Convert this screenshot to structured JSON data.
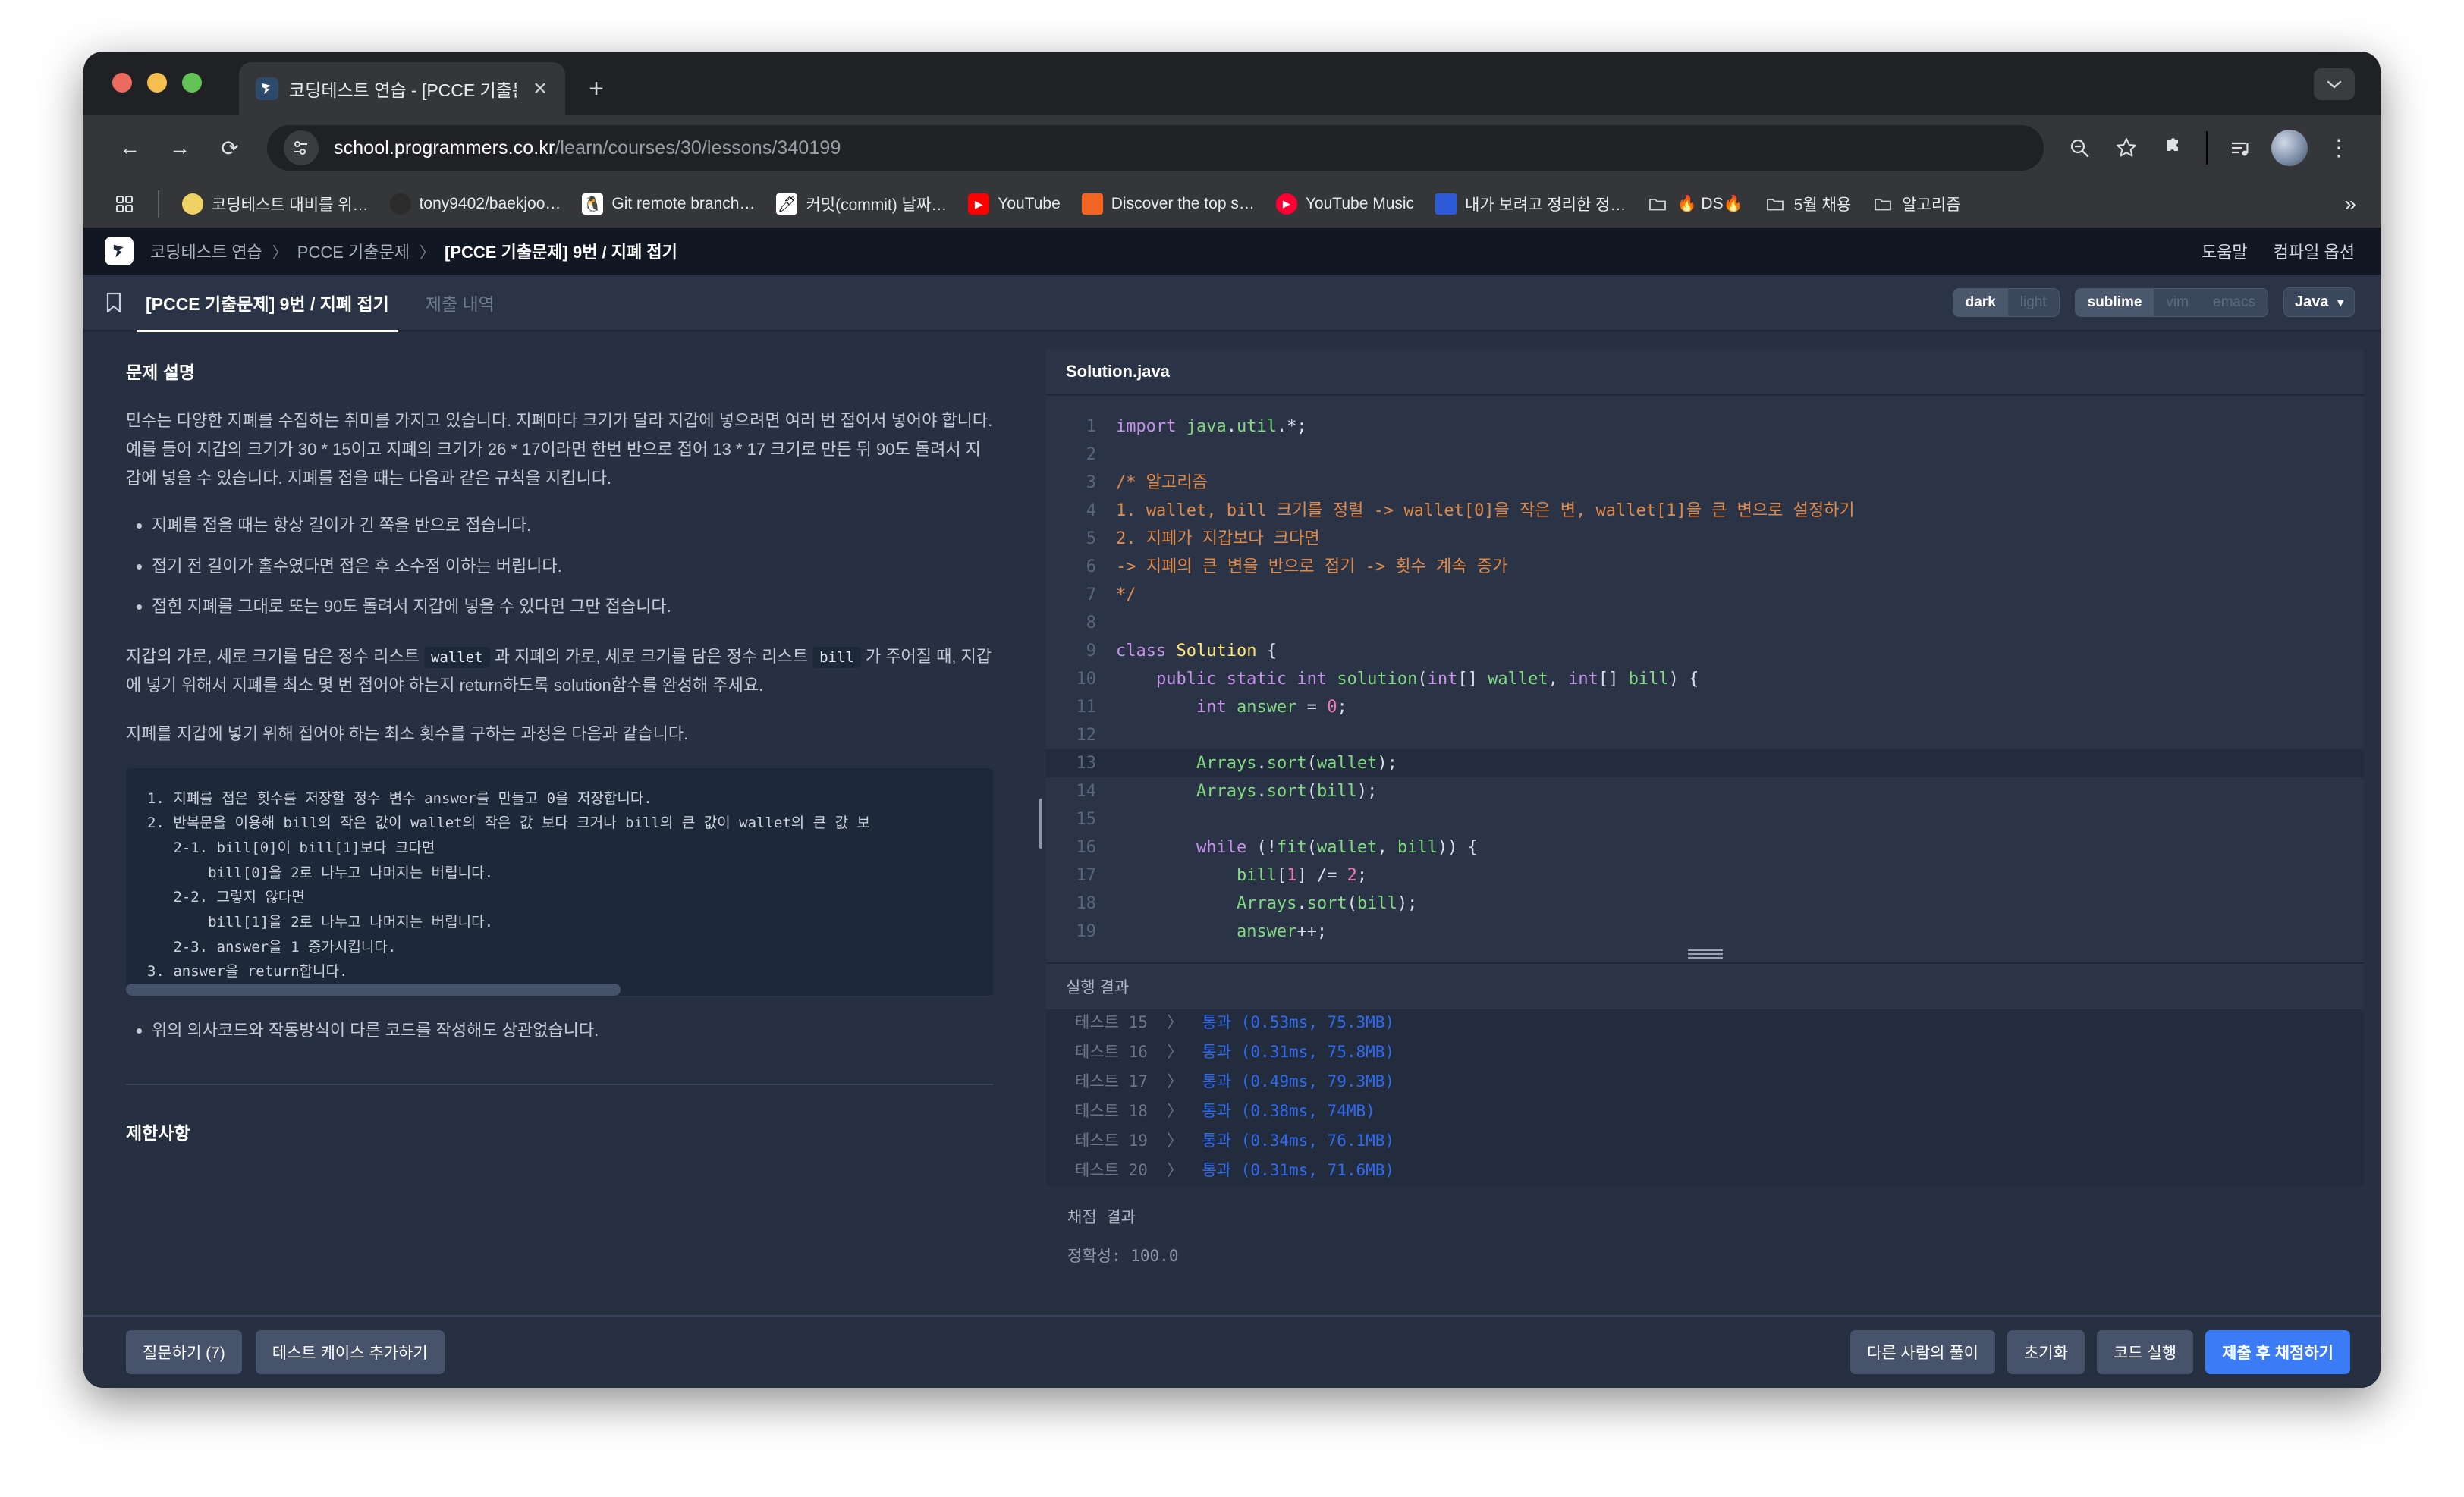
{
  "browser": {
    "tab": {
      "title": "코딩테스트 연습 - [PCCE 기출문",
      "close": "✕"
    },
    "newtab_label": "+",
    "window_controls": {
      "minimize": "",
      "maximize": "",
      "close": ""
    },
    "toolbar": {
      "back": "←",
      "forward": "→",
      "reload": "⟳",
      "url_host": "school.programmers.co.kr",
      "url_path": "/learn/courses/30/lessons/340199",
      "zoom_icon": "zoom-out-icon",
      "bookmark_icon": "star-icon",
      "extensions_icon": "puzzle-icon",
      "media_icon": "media-list-icon",
      "menu_icon": "⋮"
    },
    "bookmarks": [
      {
        "label": "코딩테스트 대비를 위…",
        "icon": "🟡"
      },
      {
        "label": "tony9402/baekjoo…",
        "icon": "⚫"
      },
      {
        "label": "Git remote branch…",
        "icon": "🐧"
      },
      {
        "label": "커밋(commit) 날짜…",
        "icon": "🖊"
      },
      {
        "label": "YouTube",
        "icon": "▶"
      },
      {
        "label": "Discover the top s…",
        "icon": "📊"
      },
      {
        "label": "YouTube Music",
        "icon": "⏵"
      },
      {
        "label": "내가 보려고 정리한 정…",
        "icon": "📘"
      },
      {
        "label": "🔥 DS🔥",
        "icon": "📁"
      },
      {
        "label": "5월 채용",
        "icon": "📁"
      },
      {
        "label": "알고리즘",
        "icon": "📁"
      }
    ],
    "bookmarks_overflow": "»"
  },
  "header": {
    "breadcrumb": [
      {
        "label": "코딩테스트 연습",
        "active": false
      },
      {
        "label": "PCCE 기출문제",
        "active": false
      },
      {
        "label": "[PCCE 기출문제] 9번 / 지폐 접기",
        "active": true
      }
    ],
    "separator": "〉",
    "links": [
      "도움말",
      "컴파일 옵션"
    ]
  },
  "tabs": {
    "items": [
      {
        "label": "[PCCE 기출문제] 9번 / 지폐 접기",
        "active": true
      },
      {
        "label": "제출 내역",
        "active": false
      }
    ],
    "theme_segment": {
      "options": [
        "dark",
        "light"
      ],
      "selected": "dark"
    },
    "keymap_segment": {
      "options": [
        "sublime",
        "vim",
        "emacs"
      ],
      "selected": "sublime"
    },
    "language": {
      "value": "Java",
      "caret": "▾"
    }
  },
  "problem": {
    "section_title": "문제 설명",
    "paragraph1": "민수는 다양한 지폐를 수집하는 취미를 가지고 있습니다. 지폐마다 크기가 달라 지갑에 넣으려면 여러 번 접어서 넣어야 합니다. 예를 들어 지갑의 크기가 30 * 15이고 지폐의 크기가 26 * 17이라면 한번 반으로 접어 13 * 17 크기로 만든 뒤 90도 돌려서 지갑에 넣을 수 있습니다. 지폐를 접을 때는 다음과 같은 규칙을 지킵니다.",
    "rules": [
      "지폐를 접을 때는 항상 길이가 긴 쪽을 반으로 접습니다.",
      "접기 전 길이가 홀수였다면 접은 후 소수점 이하는 버립니다.",
      "접힌 지폐를 그대로 또는 90도 돌려서 지갑에 넣을 수 있다면 그만 접습니다."
    ],
    "paragraph2_pre": "지갑의 가로, 세로 크기를 담은 정수 리스트 ",
    "code_wallet": "wallet",
    "paragraph2_mid": " 과 지폐의 가로, 세로 크기를 담은 정수 리스트 ",
    "code_bill": "bill",
    "paragraph2_post": " 가 주어질 때, 지갑에 넣기 위해서 지폐를 최소 몇 번 접어야 하는지 return하도록 solution함수를 완성해 주세요.",
    "paragraph3": "지폐를 지갑에 넣기 위해 접어야 하는 최소 횟수를 구하는 과정은 다음과 같습니다.",
    "pseudocode": "1. 지폐를 접은 횟수를 저장할 정수 변수 answer를 만들고 0을 저장합니다.\n2. 반복문을 이용해 bill의 작은 값이 wallet의 작은 값 보다 크거나 bill의 큰 값이 wallet의 큰 값 보\n   2-1. bill[0]이 bill[1]보다 크다면\n       bill[0]을 2로 나누고 나머지는 버립니다.\n   2-2. 그렇지 않다면\n       bill[1]을 2로 나누고 나머지는 버립니다.\n   2-3. answer을 1 증가시킵니다.\n3. answer을 return합니다.",
    "note": "위의 의사코드와 작동방식이 다른 코드를 작성해도 상관없습니다.",
    "constraints_title": "제한사항"
  },
  "editor": {
    "filename": "Solution.java",
    "lines": [
      {
        "n": 1,
        "tokens": [
          {
            "t": "import ",
            "c": "k"
          },
          {
            "t": "java",
            "c": "fn"
          },
          {
            "t": ".",
            "c": "ct"
          },
          {
            "t": "util",
            "c": "fn"
          },
          {
            "t": ".*;",
            "c": "ct"
          }
        ]
      },
      {
        "n": 2,
        "tokens": []
      },
      {
        "n": 3,
        "tokens": [
          {
            "t": "/* 알고리즘",
            "c": "cm"
          }
        ]
      },
      {
        "n": 4,
        "tokens": [
          {
            "t": "1. wallet, bill 크기를 정렬 -> wallet[0]을 작은 변, wallet[1]을 큰 변으로 설정하기",
            "c": "cm"
          }
        ]
      },
      {
        "n": 5,
        "tokens": [
          {
            "t": "2. 지폐가 지갑보다 크다면",
            "c": "cm"
          }
        ]
      },
      {
        "n": 6,
        "tokens": [
          {
            "t": "-> 지폐의 큰 변을 반으로 접기 -> 횟수 계속 증가",
            "c": "cm"
          }
        ]
      },
      {
        "n": 7,
        "tokens": [
          {
            "t": "*/",
            "c": "cm"
          }
        ]
      },
      {
        "n": 8,
        "tokens": []
      },
      {
        "n": 9,
        "tokens": [
          {
            "t": "class ",
            "c": "k"
          },
          {
            "t": "Solution",
            "c": "cls"
          },
          {
            "t": " {",
            "c": "ct"
          }
        ]
      },
      {
        "n": 10,
        "tokens": [
          {
            "t": "    public static ",
            "c": "k"
          },
          {
            "t": "int ",
            "c": "k"
          },
          {
            "t": "solution",
            "c": "fn"
          },
          {
            "t": "(",
            "c": "ct"
          },
          {
            "t": "int",
            "c": "k"
          },
          {
            "t": "[] ",
            "c": "ct"
          },
          {
            "t": "wallet",
            "c": "fn"
          },
          {
            "t": ", ",
            "c": "ct"
          },
          {
            "t": "int",
            "c": "k"
          },
          {
            "t": "[] ",
            "c": "ct"
          },
          {
            "t": "bill",
            "c": "fn"
          },
          {
            "t": ") {",
            "c": "ct"
          }
        ]
      },
      {
        "n": 11,
        "tokens": [
          {
            "t": "        int ",
            "c": "k"
          },
          {
            "t": "answer",
            "c": "fn"
          },
          {
            "t": " = ",
            "c": "ct"
          },
          {
            "t": "0",
            "c": "num"
          },
          {
            "t": ";",
            "c": "ct"
          }
        ]
      },
      {
        "n": 12,
        "tokens": []
      },
      {
        "n": 13,
        "tokens": [
          {
            "t": "        ",
            "c": "ct"
          },
          {
            "t": "Arrays",
            "c": "fn"
          },
          {
            "t": ".",
            "c": "ct"
          },
          {
            "t": "sort",
            "c": "fn"
          },
          {
            "t": "(",
            "c": "ct"
          },
          {
            "t": "wallet",
            "c": "fn"
          },
          {
            "t": ");",
            "c": "ct"
          }
        ],
        "highlight": true
      },
      {
        "n": 14,
        "tokens": [
          {
            "t": "        ",
            "c": "ct"
          },
          {
            "t": "Arrays",
            "c": "fn"
          },
          {
            "t": ".",
            "c": "ct"
          },
          {
            "t": "sort",
            "c": "fn"
          },
          {
            "t": "(",
            "c": "ct"
          },
          {
            "t": "bill",
            "c": "fn"
          },
          {
            "t": ");",
            "c": "ct"
          }
        ]
      },
      {
        "n": 15,
        "tokens": []
      },
      {
        "n": 16,
        "tokens": [
          {
            "t": "        ",
            "c": "ct"
          },
          {
            "t": "while",
            "c": "k"
          },
          {
            "t": " (!",
            "c": "ct"
          },
          {
            "t": "fit",
            "c": "fn"
          },
          {
            "t": "(",
            "c": "ct"
          },
          {
            "t": "wallet",
            "c": "fn"
          },
          {
            "t": ", ",
            "c": "ct"
          },
          {
            "t": "bill",
            "c": "fn"
          },
          {
            "t": ")) {",
            "c": "ct"
          }
        ]
      },
      {
        "n": 17,
        "tokens": [
          {
            "t": "            ",
            "c": "ct"
          },
          {
            "t": "bill",
            "c": "fn"
          },
          {
            "t": "[",
            "c": "ct"
          },
          {
            "t": "1",
            "c": "num"
          },
          {
            "t": "] /= ",
            "c": "ct"
          },
          {
            "t": "2",
            "c": "num"
          },
          {
            "t": ";",
            "c": "ct"
          }
        ]
      },
      {
        "n": 18,
        "tokens": [
          {
            "t": "            ",
            "c": "ct"
          },
          {
            "t": "Arrays",
            "c": "fn"
          },
          {
            "t": ".",
            "c": "ct"
          },
          {
            "t": "sort",
            "c": "fn"
          },
          {
            "t": "(",
            "c": "ct"
          },
          {
            "t": "bill",
            "c": "fn"
          },
          {
            "t": ");",
            "c": "ct"
          }
        ]
      },
      {
        "n": 19,
        "tokens": [
          {
            "t": "            ",
            "c": "ct"
          },
          {
            "t": "answer",
            "c": "fn"
          },
          {
            "t": "++;",
            "c": "ct"
          }
        ]
      }
    ]
  },
  "run_result": {
    "title": "실행 결과",
    "tests": [
      {
        "name": "테스트 15",
        "arrow": "〉",
        "status": "통과",
        "detail": "(0.53ms, 75.3MB)"
      },
      {
        "name": "테스트 16",
        "arrow": "〉",
        "status": "통과",
        "detail": "(0.31ms, 75.8MB)"
      },
      {
        "name": "테스트 17",
        "arrow": "〉",
        "status": "통과",
        "detail": "(0.49ms, 79.3MB)"
      },
      {
        "name": "테스트 18",
        "arrow": "〉",
        "status": "통과",
        "detail": "(0.38ms, 74MB)"
      },
      {
        "name": "테스트 19",
        "arrow": "〉",
        "status": "통과",
        "detail": "(0.34ms, 76.1MB)"
      },
      {
        "name": "테스트 20",
        "arrow": "〉",
        "status": "통과",
        "detail": "(0.31ms, 71.6MB)"
      }
    ],
    "score_title": "채점 결과",
    "score_line": "정확성: 100.0"
  },
  "actions": {
    "left": [
      "질문하기 (7)",
      "테스트 케이스 추가하기"
    ],
    "right": [
      "다른 사람의 풀이",
      "초기화",
      "코드 실행"
    ],
    "primary": "제출 후 채점하기"
  },
  "colors": {
    "accent": "#3b7bf6",
    "pass": "#2f6bf2",
    "page_bg": "#263041",
    "panel_bg": "#2b3446"
  }
}
